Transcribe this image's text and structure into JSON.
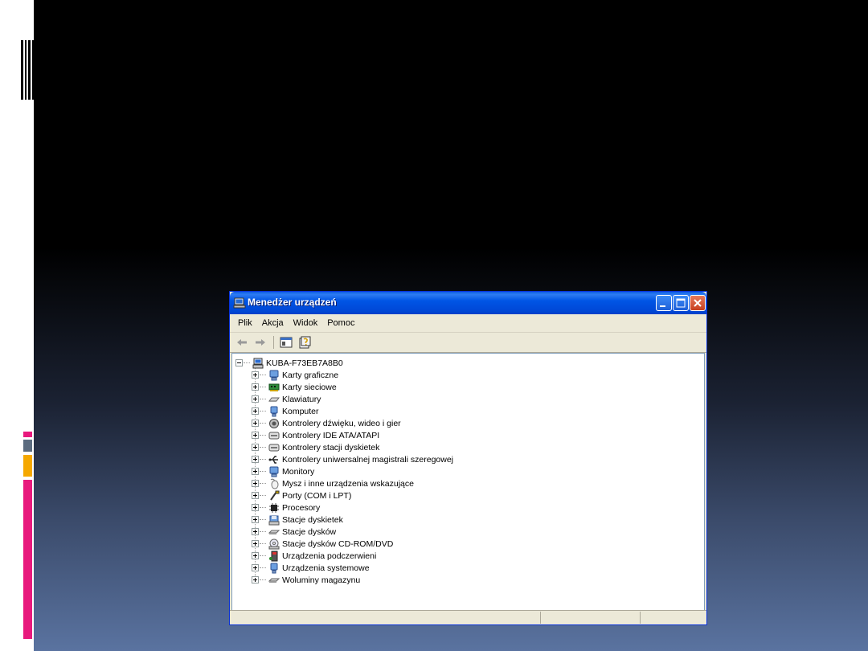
{
  "window": {
    "title": "Menedżer urządzeń"
  },
  "menu": [
    "Plik",
    "Akcja",
    "Widok",
    "Pomoc"
  ],
  "tree": {
    "root": "KUBA-F73EB7A8B0",
    "items": [
      {
        "label": "Karty graficzne",
        "icon": "display-adapter-icon"
      },
      {
        "label": "Karty sieciowe",
        "icon": "network-card-icon"
      },
      {
        "label": "Klawiatury",
        "icon": "keyboard-icon"
      },
      {
        "label": "Komputer",
        "icon": "computer-icon"
      },
      {
        "label": "Kontrolery dźwięku, wideo i gier",
        "icon": "sound-icon"
      },
      {
        "label": "Kontrolery IDE ATA/ATAPI",
        "icon": "ide-controller-icon"
      },
      {
        "label": "Kontrolery stacji dyskietek",
        "icon": "floppy-controller-icon"
      },
      {
        "label": "Kontrolery uniwersalnej magistrali szeregowej",
        "icon": "usb-icon"
      },
      {
        "label": "Monitory",
        "icon": "monitor-icon"
      },
      {
        "label": "Mysz i inne urządzenia wskazujące",
        "icon": "mouse-icon"
      },
      {
        "label": "Porty (COM i LPT)",
        "icon": "port-icon"
      },
      {
        "label": "Procesory",
        "icon": "processor-icon"
      },
      {
        "label": "Stacje dyskietek",
        "icon": "floppy-drive-icon"
      },
      {
        "label": "Stacje dysków",
        "icon": "disk-drive-icon"
      },
      {
        "label": "Stacje dysków CD-ROM/DVD",
        "icon": "cdrom-icon"
      },
      {
        "label": "Urządzenia podczerwieni",
        "icon": "infrared-icon"
      },
      {
        "label": "Urządzenia systemowe",
        "icon": "system-device-icon"
      },
      {
        "label": "Woluminy magazynu",
        "icon": "storage-volume-icon"
      }
    ]
  },
  "colors": {
    "accent_magenta": "#e8197d",
    "accent_gray": "#5b6b7f",
    "accent_orange": "#f5a800",
    "titlebar_blue": "#0055e5"
  }
}
